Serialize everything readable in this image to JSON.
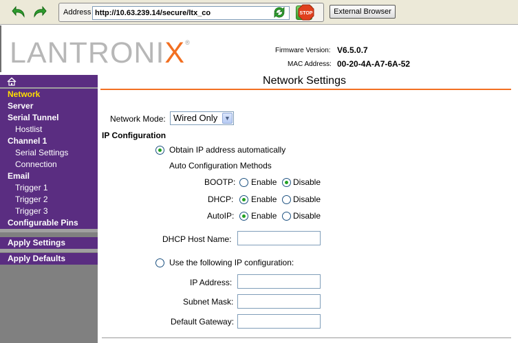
{
  "toolbar": {
    "address_label": "Address",
    "url": "http://10.63.239.14/secure/ltx_co",
    "go_label": "Go",
    "stop_label": "STOP",
    "external_browser_label": "External Browser"
  },
  "header": {
    "logo_text_main": "LANTRONI",
    "logo_text_x": "X",
    "logo_reg": "®",
    "firmware_label": "Firmware Version:",
    "firmware_value": "V6.5.0.7",
    "mac_label": "MAC Address:",
    "mac_value": "00-20-4A-A7-6A-52"
  },
  "sidebar": {
    "home_icon": "home-icon",
    "group1": [
      "Network",
      "Server",
      "Serial Tunnel",
      "Hostlist",
      "Channel 1",
      "Serial Settings",
      "Connection",
      "Email",
      "Trigger 1",
      "Trigger 2",
      "Trigger 3",
      "Configurable Pins"
    ],
    "apply_settings": "Apply Settings",
    "apply_defaults": "Apply Defaults",
    "active_color": "#ffde00"
  },
  "main": {
    "title": "Network Settings",
    "network_mode_label": "Network Mode:",
    "network_mode_value": "Wired Only",
    "ip_config_heading": "IP Configuration",
    "obtain_auto_label": "Obtain IP address automatically",
    "auto_methods_label": "Auto Configuration Methods",
    "bootp_label": "BOOTP:",
    "dhcp_label": "DHCP:",
    "autoip_label": "AutoIP:",
    "enable_label": "Enable",
    "disable_label": "Disable",
    "dhcp_host_label": "DHCP Host Name:",
    "use_following_label": "Use the following IP configuration:",
    "ip_address_label": "IP Address:",
    "subnet_mask_label": "Subnet Mask:",
    "default_gateway_label": "Default Gateway:"
  },
  "colors": {
    "sidebar_purple": "#5a2d81",
    "accent_orange": "#f26f21"
  }
}
